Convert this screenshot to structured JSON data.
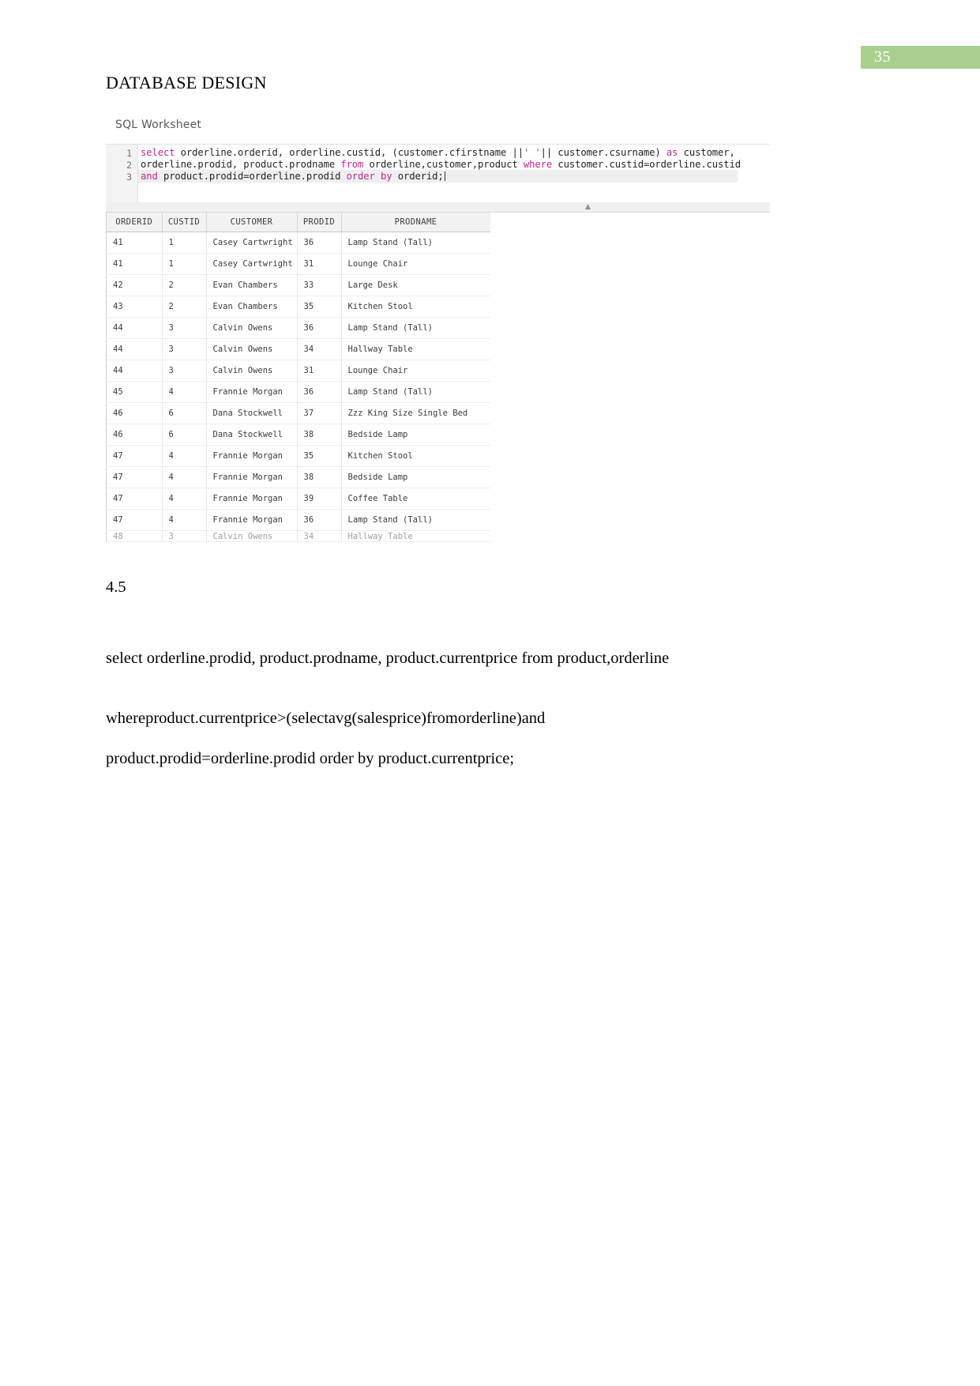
{
  "page": {
    "number": "35",
    "badge_color": "#a9cf8e",
    "heading": "DATABASE DESIGN"
  },
  "screenshot": {
    "tab_label": "SQL Worksheet",
    "editor": {
      "line_numbers": [
        "1",
        "2",
        "3"
      ],
      "lines": [
        {
          "n": "1",
          "tokens": [
            {
              "t": "select",
              "k": "kw"
            },
            {
              "t": " orderline.orderid, orderline.custid, (customer.cfirstname ||",
              "k": "plain"
            },
            {
              "t": "' '",
              "k": "str"
            },
            {
              "t": "|| customer.csurname) ",
              "k": "plain"
            },
            {
              "t": "as",
              "k": "kw"
            },
            {
              "t": " customer,",
              "k": "plain"
            }
          ]
        },
        {
          "n": "2",
          "tokens": [
            {
              "t": "orderline.prodid, product.prodname ",
              "k": "plain"
            },
            {
              "t": "from",
              "k": "kw"
            },
            {
              "t": " orderline,customer,product ",
              "k": "plain"
            },
            {
              "t": "where",
              "k": "kw"
            },
            {
              "t": " customer.custid=orderline.custid",
              "k": "plain"
            }
          ]
        },
        {
          "n": "3",
          "tokens": [
            {
              "t": "and",
              "k": "kw"
            },
            {
              "t": " product.prodid=orderline.prodid ",
              "k": "plain"
            },
            {
              "t": "order",
              "k": "kw"
            },
            {
              "t": " ",
              "k": "plain"
            },
            {
              "t": "by",
              "k": "kw"
            },
            {
              "t": " orderid;",
              "k": "plain"
            }
          ]
        }
      ],
      "splitter_icon": "▲"
    },
    "results": {
      "columns": [
        "ORDERID",
        "CUSTID",
        "CUSTOMER",
        "PRODID",
        "PRODNAME"
      ],
      "rows": [
        [
          "41",
          "1",
          "Casey Cartwright",
          "36",
          "Lamp Stand (Tall)"
        ],
        [
          "41",
          "1",
          "Casey Cartwright",
          "31",
          "Lounge Chair"
        ],
        [
          "42",
          "2",
          "Evan Chambers",
          "33",
          "Large Desk"
        ],
        [
          "43",
          "2",
          "Evan Chambers",
          "35",
          "Kitchen Stool"
        ],
        [
          "44",
          "3",
          "Calvin Owens",
          "36",
          "Lamp Stand (Tall)"
        ],
        [
          "44",
          "3",
          "Calvin Owens",
          "34",
          "Hallway Table"
        ],
        [
          "44",
          "3",
          "Calvin Owens",
          "31",
          "Lounge Chair"
        ],
        [
          "45",
          "4",
          "Frannie Morgan",
          "36",
          "Lamp Stand (Tall)"
        ],
        [
          "46",
          "6",
          "Dana Stockwell",
          "37",
          "Zzz King Size Single Bed"
        ],
        [
          "46",
          "6",
          "Dana Stockwell",
          "38",
          "Bedside Lamp"
        ],
        [
          "47",
          "4",
          "Frannie Morgan",
          "35",
          "Kitchen Stool"
        ],
        [
          "47",
          "4",
          "Frannie Morgan",
          "38",
          "Bedside Lamp"
        ],
        [
          "47",
          "4",
          "Frannie Morgan",
          "39",
          "Coffee Table"
        ],
        [
          "47",
          "4",
          "Frannie Morgan",
          "36",
          "Lamp Stand (Tall)"
        ]
      ],
      "clipped_row": [
        "48",
        "3",
        "Calvin Owens",
        "34",
        "Hallway Table"
      ]
    }
  },
  "body": {
    "section_number": "4.5",
    "query_line_1": "select orderline.prodid, product.prodname, product.currentprice from product,orderline",
    "query_line_2_words": [
      "where",
      "product.currentprice>(select",
      "avg(salesprice)",
      "from",
      "orderline)",
      "and"
    ],
    "query_line_3": "product.prodid=orderline.prodid order by product.currentprice;"
  }
}
